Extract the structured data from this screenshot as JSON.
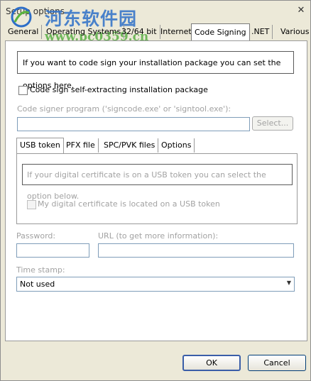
{
  "window": {
    "title": "Setup options",
    "close_glyph": "✕"
  },
  "watermark": {
    "cn_text": "河东软件园",
    "url": "www.pc0359.cn"
  },
  "tabs": [
    {
      "label": "General"
    },
    {
      "label": "Operating Systems"
    },
    {
      "label": "32/64 bit"
    },
    {
      "label": "Internet"
    },
    {
      "label": "Code Signing",
      "active": true
    },
    {
      "label": ".NET"
    },
    {
      "label": "Various"
    }
  ],
  "code_signing": {
    "info_text": "If you want to code sign your installation package you can set the options here.",
    "self_extract_label": "Code sign self-extracting installation package",
    "self_extract_checked": false,
    "signer_program_label": "Code signer program ('signcode.exe' or 'signtool.exe'):",
    "signer_program_value": "",
    "select_button": "Select...",
    "inner_tabs": [
      {
        "label": "USB token",
        "active": true
      },
      {
        "label": "PFX file"
      },
      {
        "label": "SPC/PVK files"
      },
      {
        "label": "Options"
      }
    ],
    "usb_info_text": "If your digital certificate is on a USB token you can select the option below.",
    "usb_checkbox_label": "My digital certificate is located on a USB token",
    "usb_checked": false,
    "password_label": "Password:",
    "password_value": "",
    "url_label": "URL (to get more information):",
    "url_value": "",
    "timestamp_label": "Time stamp:",
    "timestamp_value": "Not used"
  },
  "buttons": {
    "ok": "OK",
    "cancel": "Cancel"
  }
}
